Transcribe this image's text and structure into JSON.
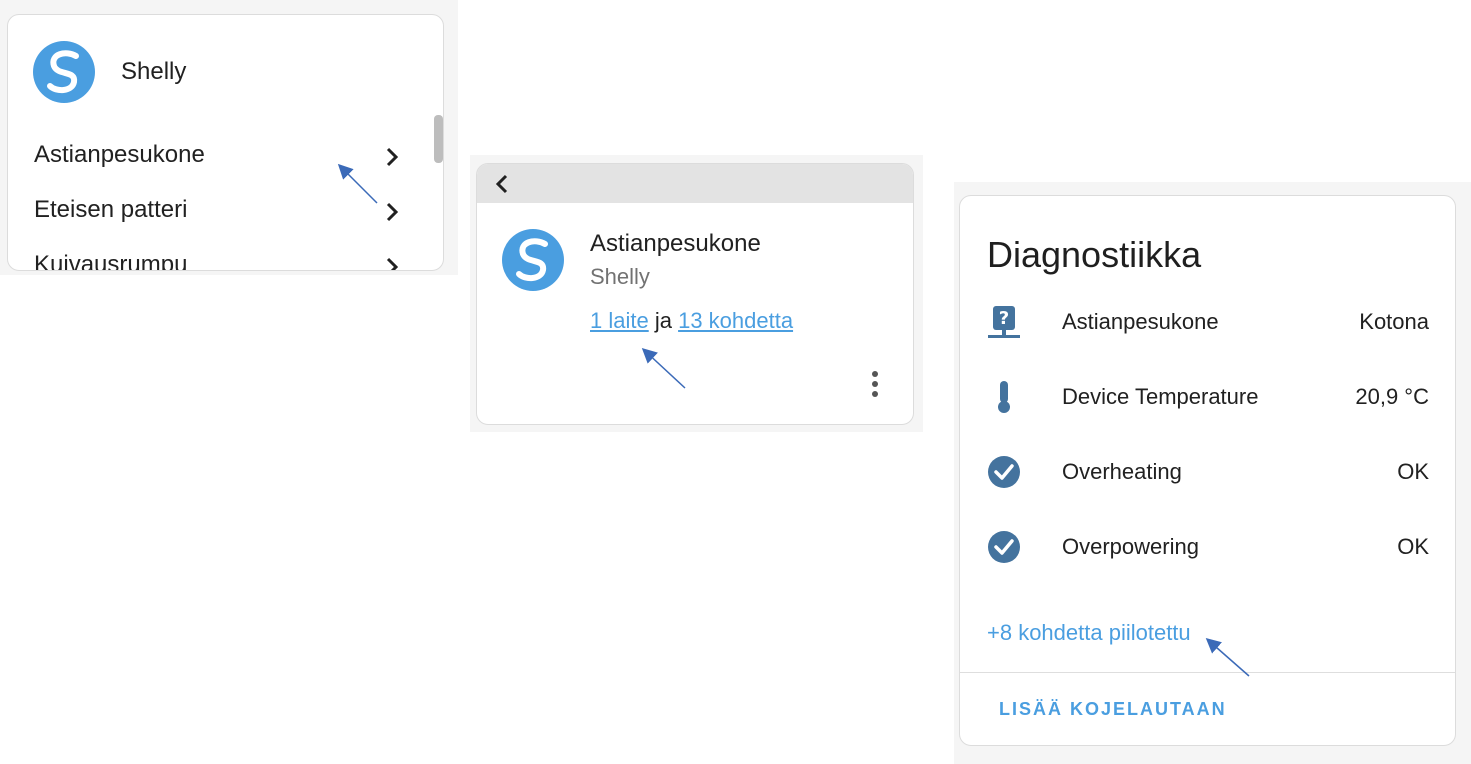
{
  "card1": {
    "brand": "Shelly",
    "items": [
      {
        "label": "Astianpesukone"
      },
      {
        "label": "Eteisen patteri"
      },
      {
        "label": "Kuivausrumpu"
      }
    ]
  },
  "card2": {
    "title": "Astianpesukone",
    "subtitle": "Shelly",
    "device_link": "1 laite",
    "joiner": " ja ",
    "entities_link": "13 kohdetta"
  },
  "card3": {
    "heading": "Diagnostiikka",
    "rows": [
      {
        "name": "Astianpesukone",
        "value": "Kotona",
        "icon": "network-question-icon"
      },
      {
        "name": "Device Temperature",
        "value": "20,9 °C",
        "icon": "thermometer-icon"
      },
      {
        "name": "Overheating",
        "value": "OK",
        "icon": "check-circle-icon"
      },
      {
        "name": "Overpowering",
        "value": "OK",
        "icon": "check-circle-icon"
      }
    ],
    "hidden_link": "+8 kohdetta piilotettu",
    "add_button": "LISÄÄ KOJELAUTAAN"
  },
  "colors": {
    "accent": "#4a9ee0",
    "icon": "#44739e",
    "logo": "#4a9ee0",
    "annotation_arrow": "#3b6ab8"
  }
}
